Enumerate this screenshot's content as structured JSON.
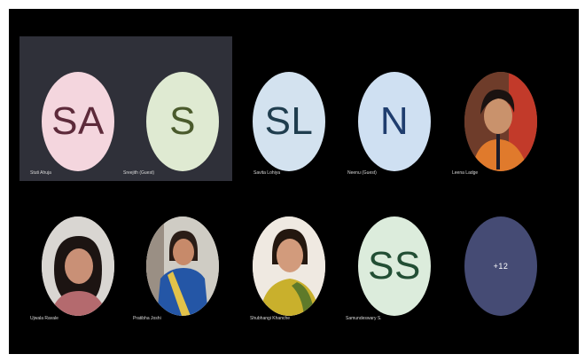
{
  "participants": [
    {
      "initials": "SA",
      "name": "Stuti Ahuja",
      "bg": "#f4d6de",
      "fg": "#5d2a3a",
      "kind": "initials"
    },
    {
      "initials": "S",
      "name": "Sreejith (Guest)",
      "bg": "#dfead2",
      "fg": "#4a5a2c",
      "kind": "initials"
    },
    {
      "initials": "SL",
      "name": "Savita Lohiya",
      "bg": "#d3e2ef",
      "fg": "#1f3d4e",
      "kind": "initials"
    },
    {
      "initials": "N",
      "name": "Neenu (Guest)",
      "bg": "#cfe0f2",
      "fg": "#1f3d6e",
      "kind": "initials"
    },
    {
      "initials": "",
      "name": "Leena Ladge",
      "kind": "photo"
    },
    {
      "initials": "",
      "name": "Ujwala Ravale",
      "kind": "photo"
    },
    {
      "initials": "",
      "name": "Pratibha Joshi",
      "kind": "photo"
    },
    {
      "initials": "",
      "name": "Shubhangi Khanche",
      "kind": "photo"
    },
    {
      "initials": "SS",
      "name": "Samundeswary S.",
      "bg": "#dcecdc",
      "fg": "#224e34",
      "kind": "initials"
    }
  ],
  "more": {
    "label": "+12",
    "bg": "#454b74",
    "fg": "#ffffff"
  }
}
